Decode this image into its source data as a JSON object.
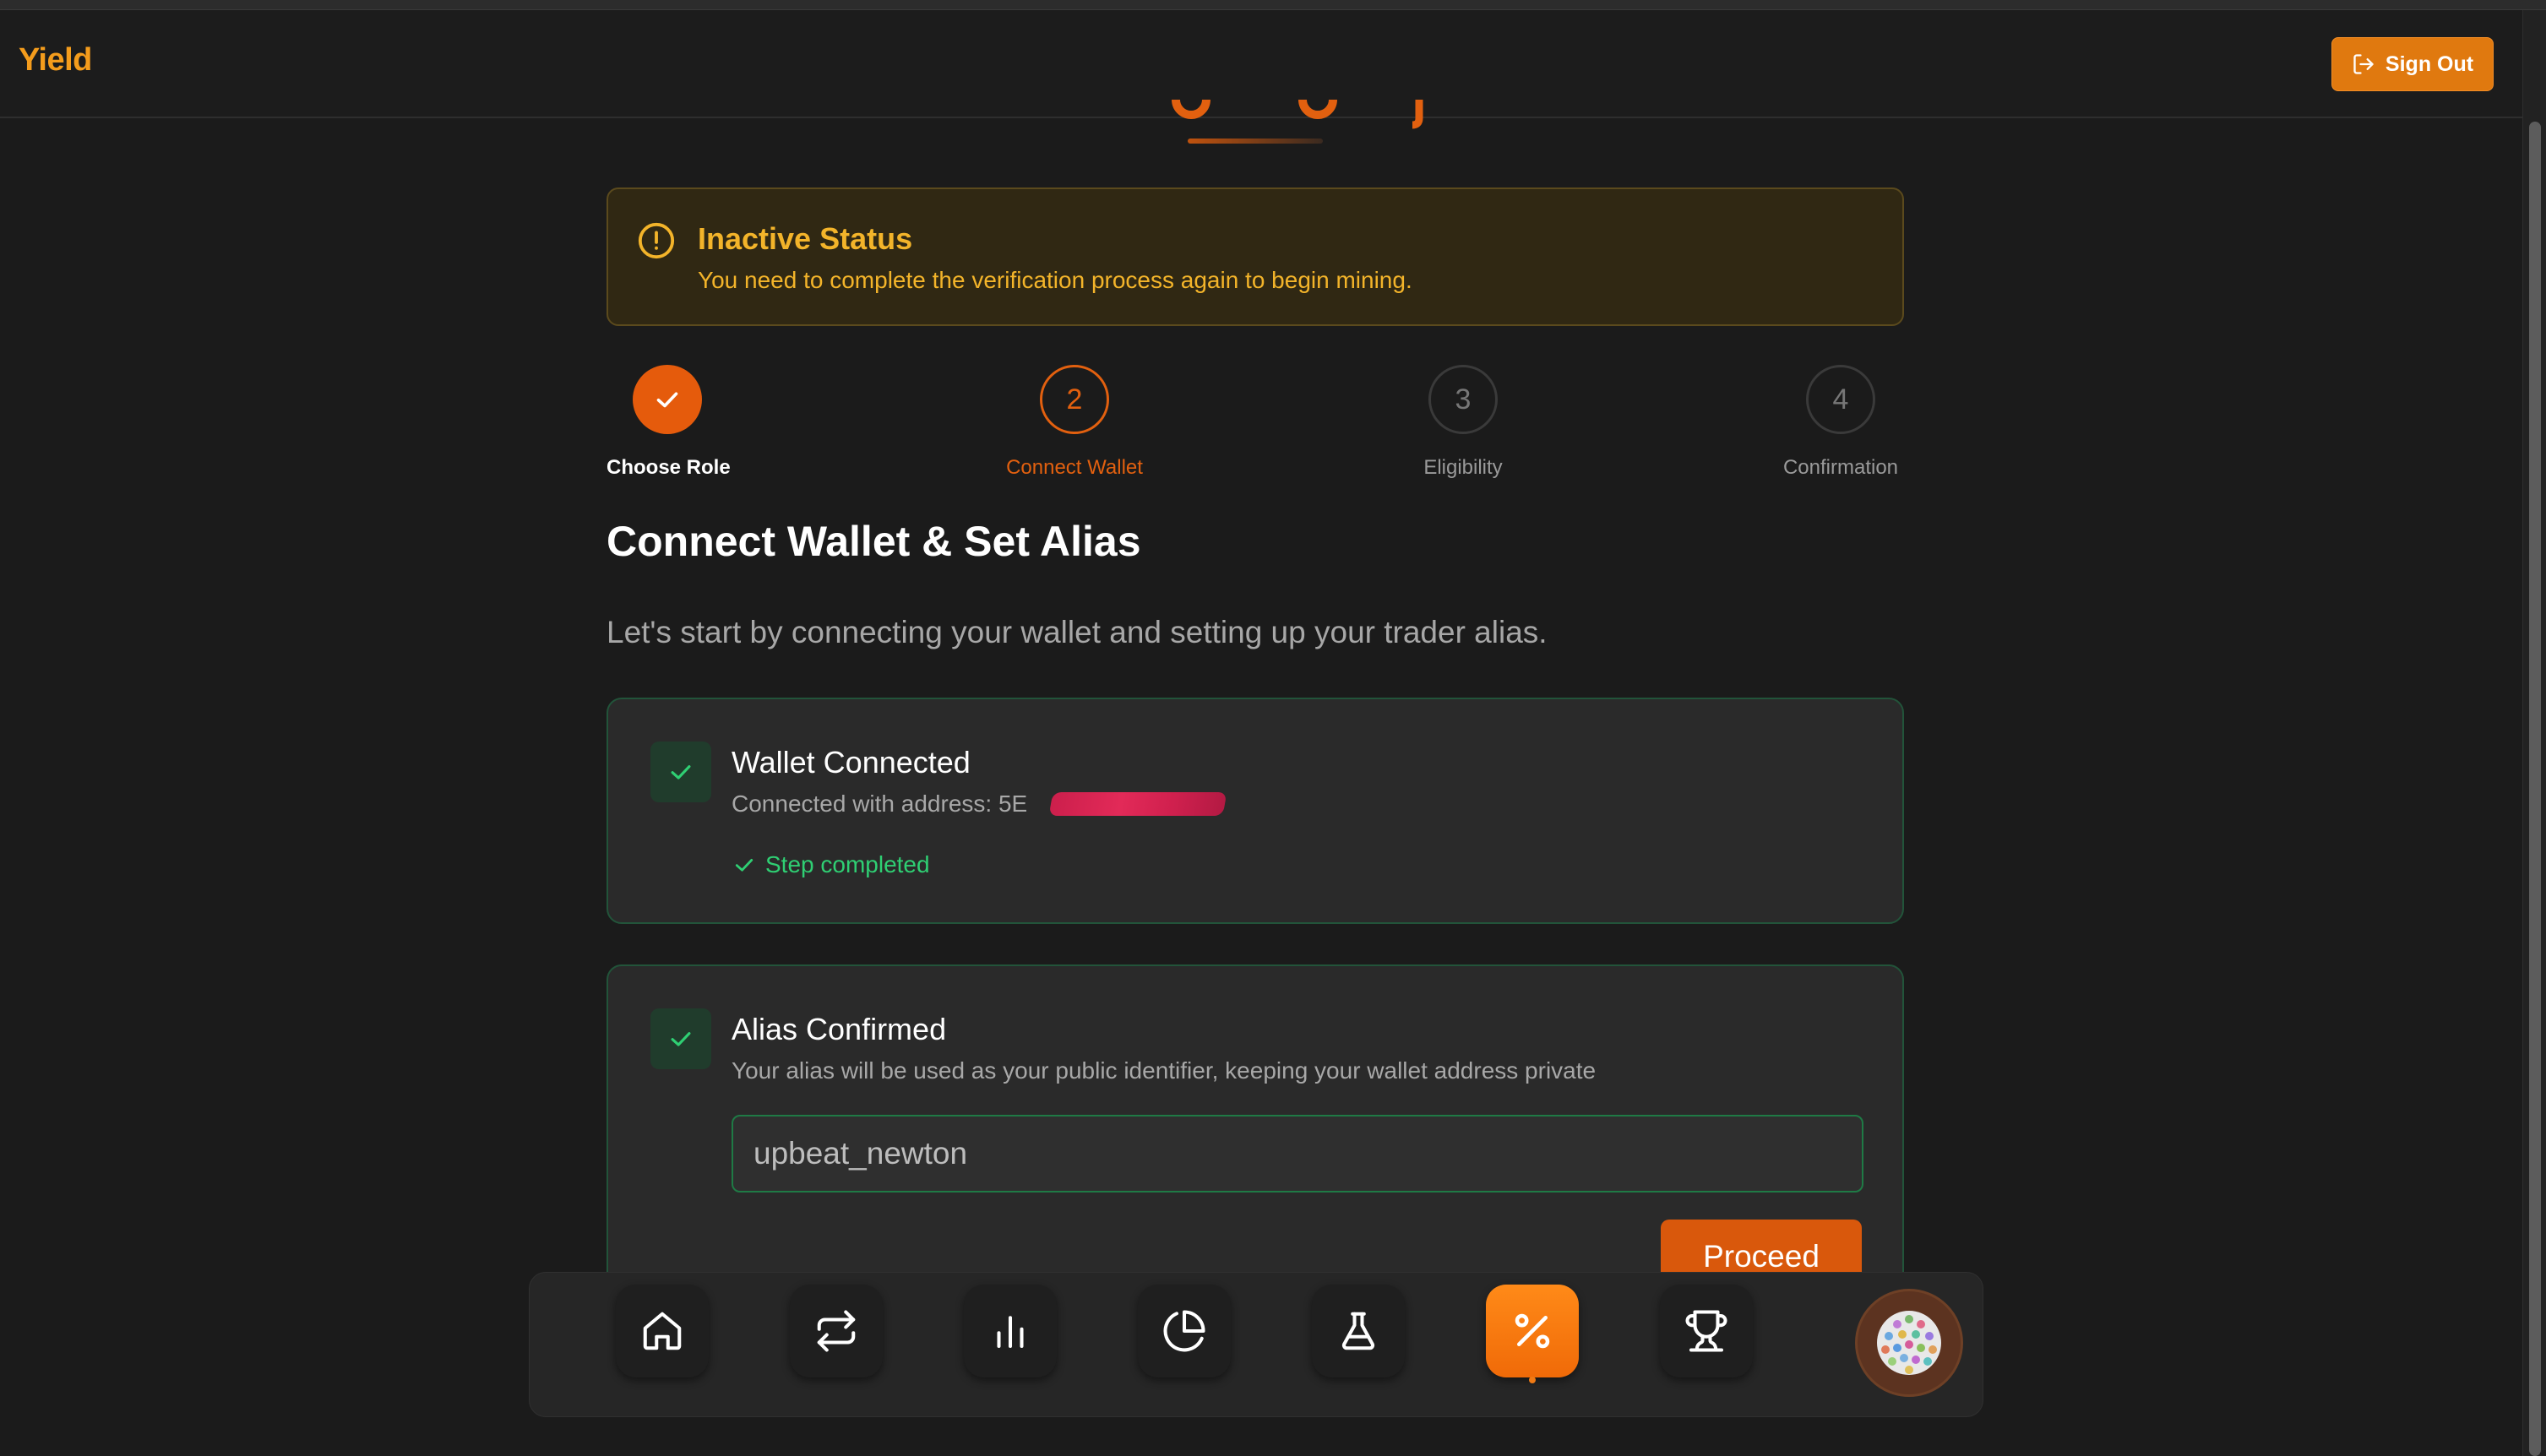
{
  "app": {
    "brand": "Yield"
  },
  "header": {
    "signout_label": "Sign Out"
  },
  "alert": {
    "title": "Inactive Status",
    "message": "You need to complete the verification process again to begin mining."
  },
  "steps": [
    {
      "number": "",
      "label": "Choose Role",
      "state": "completed"
    },
    {
      "number": "2",
      "label": "Connect Wallet",
      "state": "active"
    },
    {
      "number": "3",
      "label": "Eligibility",
      "state": "pending"
    },
    {
      "number": "4",
      "label": "Confirmation",
      "state": "pending"
    }
  ],
  "main": {
    "title": "Connect Wallet & Set Alias",
    "subtitle": "Let's start by connecting your wallet and setting up your trader alias."
  },
  "wallet_card": {
    "title": "Wallet Connected",
    "address_prefix": "Connected with address: 5E",
    "status": "Step completed"
  },
  "alias_card": {
    "title": "Alias Confirmed",
    "description": "Your alias will be used as your public identifier, keeping your wallet address private",
    "alias_value": "upbeat_newton",
    "proceed_label": "Proceed"
  },
  "dock": {
    "items": [
      {
        "icon": "home-icon"
      },
      {
        "icon": "swap-icon"
      },
      {
        "icon": "bar-chart-icon"
      },
      {
        "icon": "pie-chart-icon"
      },
      {
        "icon": "flask-icon"
      },
      {
        "icon": "percent-icon",
        "active": true
      },
      {
        "icon": "trophy-icon"
      }
    ]
  },
  "colors": {
    "accent": "#f28d26",
    "brand": "#f49c1c",
    "success": "#2fcf73",
    "warning": "#f3b42a",
    "background": "#1b1b1b"
  }
}
